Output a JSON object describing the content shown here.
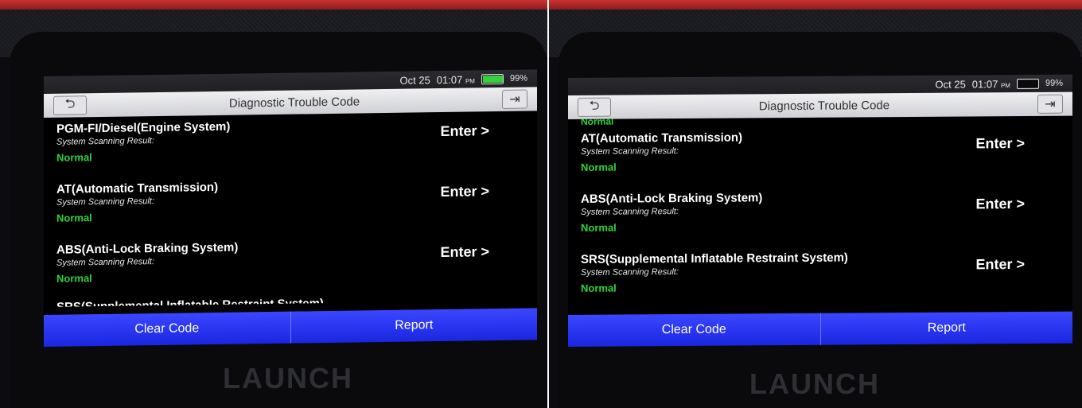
{
  "brand": "LAUNCH",
  "status": {
    "date": "Oct 25",
    "time": "01:07",
    "ampm": "PM",
    "battery": "99%"
  },
  "header": {
    "title": "Diagnostic Trouble Code",
    "back_icon": "back-arrow-icon",
    "exit_icon": "exit-icon"
  },
  "left_screen": {
    "systems": [
      {
        "name": "PGM-FI/Diesel(Engine System)",
        "label": "System Scanning Result:",
        "result": "Normal",
        "action": "Enter >"
      },
      {
        "name": "AT(Automatic Transmission)",
        "label": "System Scanning Result:",
        "result": "Normal",
        "action": "Enter >"
      },
      {
        "name": "ABS(Anti-Lock Braking System)",
        "label": "System Scanning Result:",
        "result": "Normal",
        "action": "Enter >"
      }
    ],
    "cut_off_item": "SRS(Supplemental Inflatable Restraint System)"
  },
  "right_screen": {
    "partial_result": "Normal",
    "systems": [
      {
        "name": "AT(Automatic Transmission)",
        "label": "System Scanning Result:",
        "result": "Normal",
        "action": "Enter >"
      },
      {
        "name": "ABS(Anti-Lock Braking System)",
        "label": "System Scanning Result:",
        "result": "Normal",
        "action": "Enter >"
      },
      {
        "name": "SRS(Supplemental Inflatable Restraint System)",
        "label": "System Scanning Result:",
        "result": "Normal",
        "action": "Enter >"
      }
    ]
  },
  "footer": {
    "clear_label": "Clear Code",
    "report_label": "Report"
  },
  "colors": {
    "normal": "#2bd33a",
    "footer_blue": "#2a36f0",
    "battery": "#37d13b"
  }
}
